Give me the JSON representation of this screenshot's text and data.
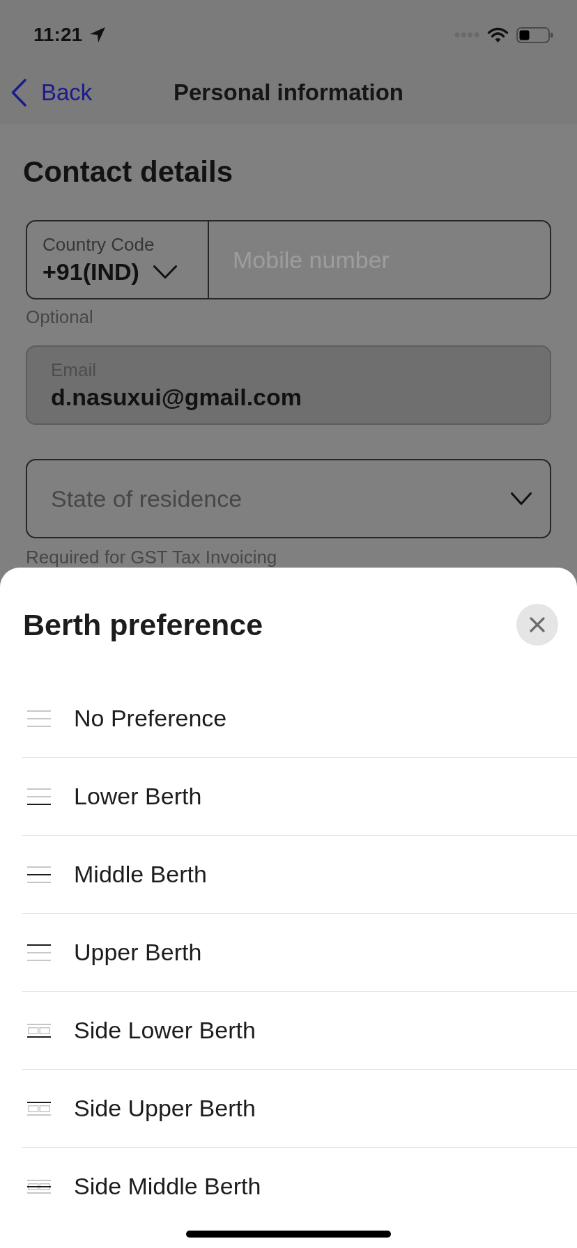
{
  "status_bar": {
    "time": "11:21"
  },
  "nav": {
    "back_label": "Back",
    "title": "Personal information"
  },
  "contact": {
    "heading": "Contact details",
    "phone": {
      "country_label": "Country Code",
      "country_value": "+91(IND)",
      "placeholder": "Mobile number",
      "hint": "Optional"
    },
    "email": {
      "label": "Email",
      "value": "d.nasuxui@gmail.com",
      "disabled": true
    },
    "state": {
      "placeholder": "State of residence",
      "hint": "Required for GST Tax Invoicing"
    }
  },
  "sheet": {
    "title": "Berth preference",
    "options": [
      {
        "label": "No Preference",
        "kind": "tier",
        "upper": false,
        "middle": false,
        "lower": false
      },
      {
        "label": "Lower Berth",
        "kind": "tier",
        "upper": false,
        "middle": false,
        "lower": true
      },
      {
        "label": "Middle Berth",
        "kind": "tier",
        "upper": false,
        "middle": true,
        "lower": false
      },
      {
        "label": "Upper Berth",
        "kind": "tier",
        "upper": true,
        "middle": false,
        "lower": false
      },
      {
        "label": "Side Lower Berth",
        "kind": "side",
        "upper": false,
        "middle": false,
        "lower": true
      },
      {
        "label": "Side Upper Berth",
        "kind": "side",
        "upper": true,
        "middle": false,
        "lower": false
      },
      {
        "label": "Side Middle Berth",
        "kind": "side",
        "upper": false,
        "middle": true,
        "lower": false
      }
    ]
  }
}
